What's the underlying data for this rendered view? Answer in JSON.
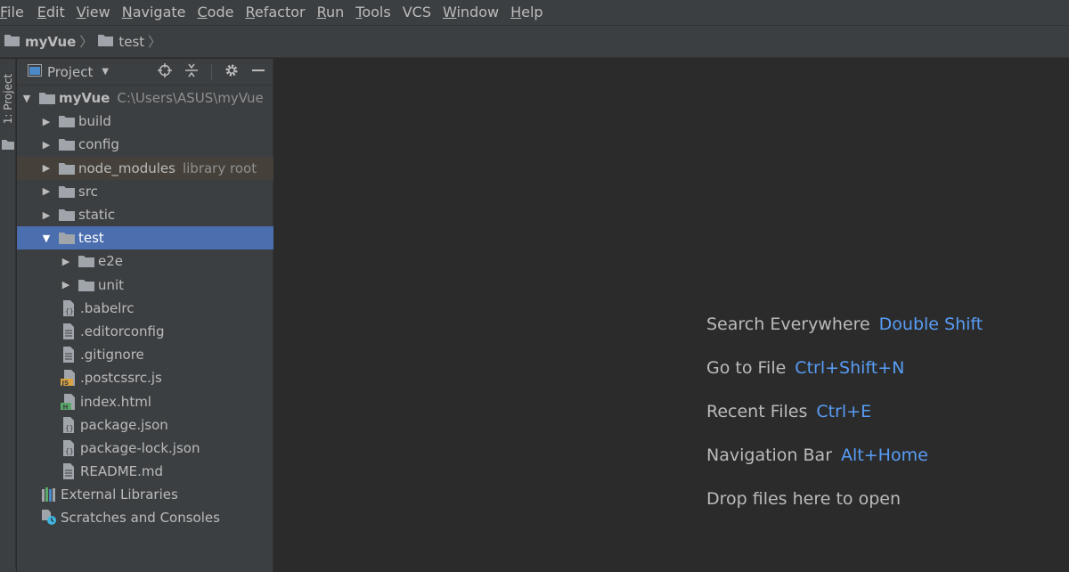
{
  "menu": [
    {
      "mnemonic": "F",
      "rest": "ile"
    },
    {
      "mnemonic": "E",
      "rest": "dit"
    },
    {
      "mnemonic": "V",
      "rest": "iew"
    },
    {
      "mnemonic": "N",
      "rest": "avigate"
    },
    {
      "mnemonic": "C",
      "rest": "ode"
    },
    {
      "mnemonic": "R",
      "rest": "efactor"
    },
    {
      "mnemonic": "R",
      "rest": "un"
    },
    {
      "mnemonic": "T",
      "rest": "ools"
    },
    {
      "mnemonic": "",
      "rest": "VCS"
    },
    {
      "mnemonic": "W",
      "rest": "indow"
    },
    {
      "mnemonic": "H",
      "rest": "elp"
    }
  ],
  "breadcrumb": {
    "root": "myVue",
    "child": "test"
  },
  "toolstrip": {
    "project_tab": "1: Project"
  },
  "panel": {
    "title": "Project",
    "root": {
      "name": "myVue",
      "path": "C:\\Users\\ASUS\\myVue"
    },
    "items": [
      {
        "label": "build"
      },
      {
        "label": "config"
      },
      {
        "label": "node_modules",
        "hint": "library root"
      },
      {
        "label": "src"
      },
      {
        "label": "static"
      },
      {
        "label": "test"
      },
      {
        "label": "e2e"
      },
      {
        "label": "unit"
      },
      {
        "label": ".babelrc"
      },
      {
        "label": ".editorconfig"
      },
      {
        "label": ".gitignore"
      },
      {
        "label": ".postcssrc.js"
      },
      {
        "label": "index.html"
      },
      {
        "label": "package.json"
      },
      {
        "label": "package-lock.json"
      },
      {
        "label": "README.md"
      },
      {
        "label": "External Libraries"
      },
      {
        "label": "Scratches and Consoles"
      }
    ]
  },
  "editor_hints": [
    {
      "label": "Search Everywhere",
      "key": "Double Shift"
    },
    {
      "label": "Go to File",
      "key": "Ctrl+Shift+N"
    },
    {
      "label": "Recent Files",
      "key": "Ctrl+E"
    },
    {
      "label": "Navigation Bar",
      "key": "Alt+Home"
    },
    {
      "label": "Drop files here to open",
      "key": ""
    }
  ],
  "colors": {
    "selection": "#4b6eaf",
    "shortcut": "#589df6",
    "background": "#2b2b2b",
    "panel": "#3c3f41"
  }
}
